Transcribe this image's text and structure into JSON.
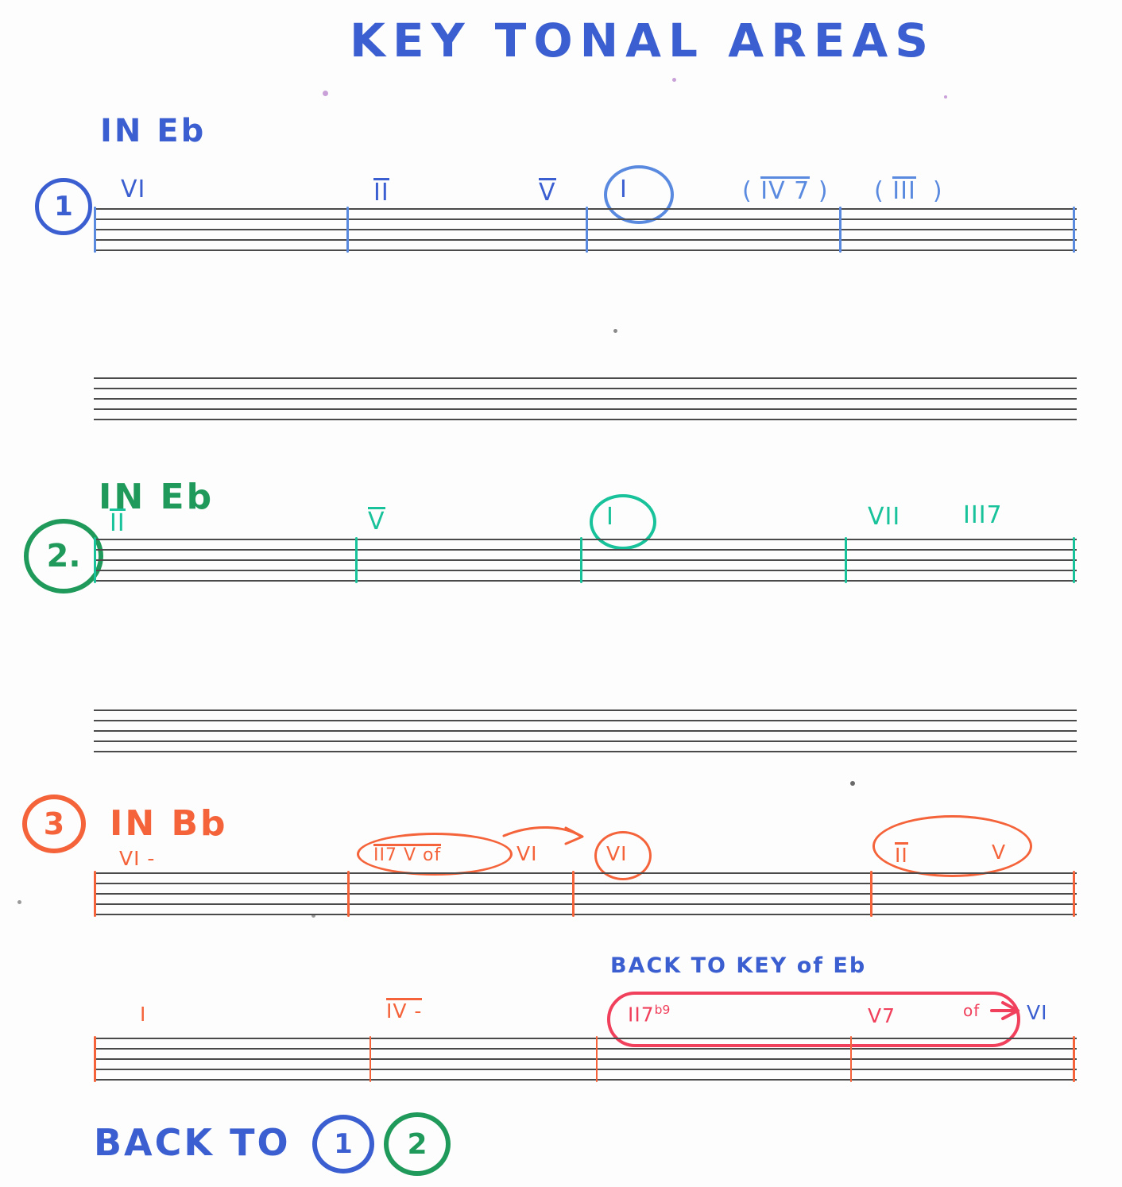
{
  "page": {
    "title": "KEY TONAL AREAS",
    "background": "#fdfdfd",
    "colors": {
      "blue": "#3b5fd0",
      "green": "#1f9a5a",
      "teal": "#18c29a",
      "orange": "#f4633a",
      "pink": "#f0405c",
      "staff": "#4a4a4a"
    }
  },
  "systems": [
    {
      "number": "1",
      "number_color": "#3b5fd0",
      "key_label": "IN Eb",
      "key_label_color": "#3b5fd0",
      "ink": "#3b5fd0",
      "chords": [
        {
          "text": "VI",
          "circled": false,
          "parens": false,
          "overline": false
        },
        {
          "text": "II",
          "circled": false,
          "parens": false,
          "overline": true
        },
        {
          "text": "V",
          "circled": false,
          "parens": false,
          "overline": true
        },
        {
          "text": "I",
          "circled": true,
          "parens": false,
          "overline": false
        },
        {
          "text": "IV 7",
          "circled": false,
          "parens": true,
          "overline": true
        },
        {
          "text": "III",
          "circled": false,
          "parens": true,
          "overline": true
        }
      ]
    },
    {
      "number": "2.",
      "number_color": "#1f9a5a",
      "key_label": "IN Eb",
      "key_label_color": "#1f9a5a",
      "ink": "#18c29a",
      "chords": [
        {
          "text": "II",
          "circled": false,
          "parens": false,
          "overline": true
        },
        {
          "text": "V",
          "circled": false,
          "parens": false,
          "overline": true
        },
        {
          "text": "I",
          "circled": true,
          "parens": false,
          "overline": false
        },
        {
          "text": "VII",
          "circled": false,
          "parens": false,
          "overline": false
        },
        {
          "text": "III7",
          "circled": false,
          "parens": false,
          "overline": false
        }
      ]
    },
    {
      "number": "3",
      "number_color": "#f4633a",
      "key_label": "IN Bb",
      "key_label_color": "#f4633a",
      "ink": "#f4633a",
      "chords": [
        {
          "text": "VI -",
          "circled": false,
          "parens": false,
          "overline": false
        },
        {
          "text": "II7 V of",
          "circled": "ellipse",
          "parens": false,
          "overline": true
        },
        {
          "text": "VI",
          "circled": false,
          "parens": false,
          "overline": false
        },
        {
          "text": "VI",
          "circled": true,
          "parens": false,
          "overline": false
        },
        {
          "text": "II",
          "circled": "ellipse-pair",
          "parens": false,
          "overline": true
        },
        {
          "text": "V",
          "circled": "ellipse-pair",
          "parens": false,
          "overline": false
        }
      ]
    },
    {
      "number": "",
      "number_color": "#f4633a",
      "key_label": "",
      "key_label_color": "#f4633a",
      "ink": "#f4633a",
      "chords": [
        {
          "text": "I",
          "circled": false,
          "parens": false,
          "overline": false
        },
        {
          "text": "IV -",
          "circled": false,
          "parens": false,
          "overline": true
        },
        {
          "text": "II7b9",
          "circled": "pill",
          "parens": false,
          "overline": false
        },
        {
          "text": "V7",
          "circled": "pill",
          "parens": false,
          "overline": false
        },
        {
          "text": "of",
          "circled": "pill",
          "parens": false,
          "overline": false
        },
        {
          "text": "VI",
          "circled": false,
          "parens": false,
          "overline": false
        }
      ]
    }
  ],
  "annotations": {
    "back_to_key": "BACK TO KEY of Eb",
    "back_to_key_color": "#3b5fd0",
    "ii7b9_root": "II7",
    "ii7b9_alt": "b9",
    "v7": "V7",
    "of": "of",
    "target_vi": "VI",
    "resolution_target": "VI",
    "secondary_dominant": "II7 V of",
    "secondary_target": "VI"
  },
  "footer": {
    "label": "BACK TO",
    "label_color": "#3b5fd0",
    "repeat_one": "1",
    "repeat_one_color": "#3b5fd0",
    "repeat_two": "2",
    "repeat_two_color": "#1f9a5a"
  },
  "empty_staves_count": 2
}
